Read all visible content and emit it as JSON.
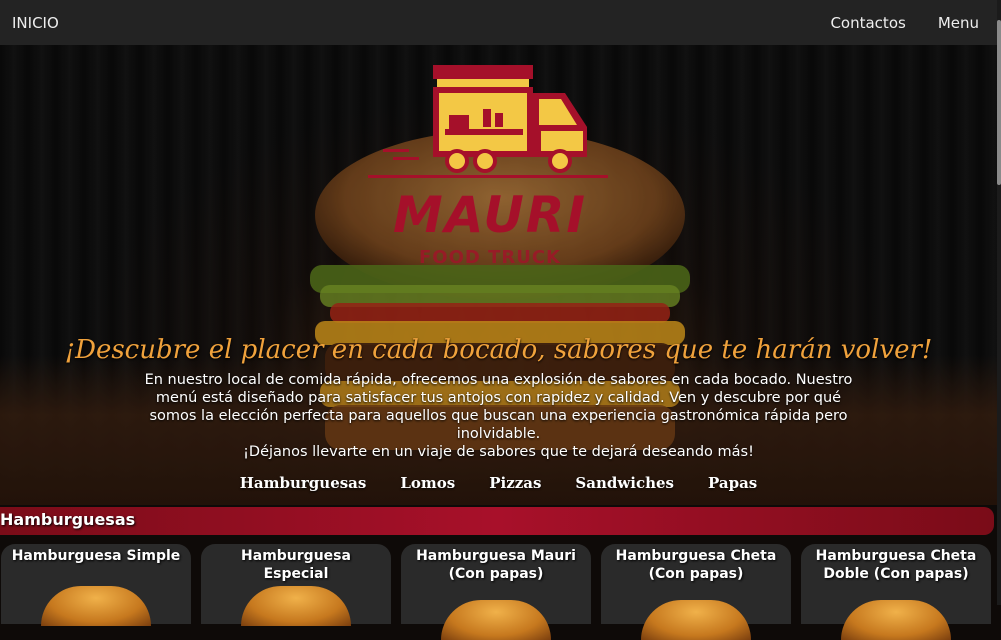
{
  "nav": {
    "home": "INICIO",
    "contacts": "Contactos",
    "menu": "Menu"
  },
  "hero": {
    "logo_title": "MAURI",
    "logo_subtitle": "FOOD TRUCK",
    "headline": "¡Descubre el placer en cada bocado, sabores que te harán volver!",
    "description": "En nuestro local de comida rápida, ofrecemos una explosión de sabores en cada bocado. Nuestro menú está diseñado para satisfacer tus antojos con rapidez y calidad. Ven y descubre por qué somos la elección perfecta para aquellos que buscan una experiencia gastronómica rápida pero inolvidable.",
    "invite": "¡Déjanos llevarte en un viaje de sabores que te dejará deseando más!"
  },
  "categories": [
    "Hamburguesas",
    "Lomos",
    "Pizzas",
    "Sandwiches",
    "Papas"
  ],
  "section": {
    "title": "Hamburguesas"
  },
  "products": [
    {
      "name": "Hamburguesa Simple"
    },
    {
      "name": "Hamburguesa Especial"
    },
    {
      "name": "Hamburguesa Mauri (Con papas)"
    },
    {
      "name": "Hamburguesa Cheta (Con papas)"
    },
    {
      "name": "Hamburguesa Cheta Doble (Con papas)"
    }
  ],
  "colors": {
    "accent_red": "#a8102a",
    "headline_orange": "#f0a23c",
    "logo_yellow": "#f3c845",
    "nav_bg": "#232323",
    "card_bg": "#2a2a2a"
  }
}
